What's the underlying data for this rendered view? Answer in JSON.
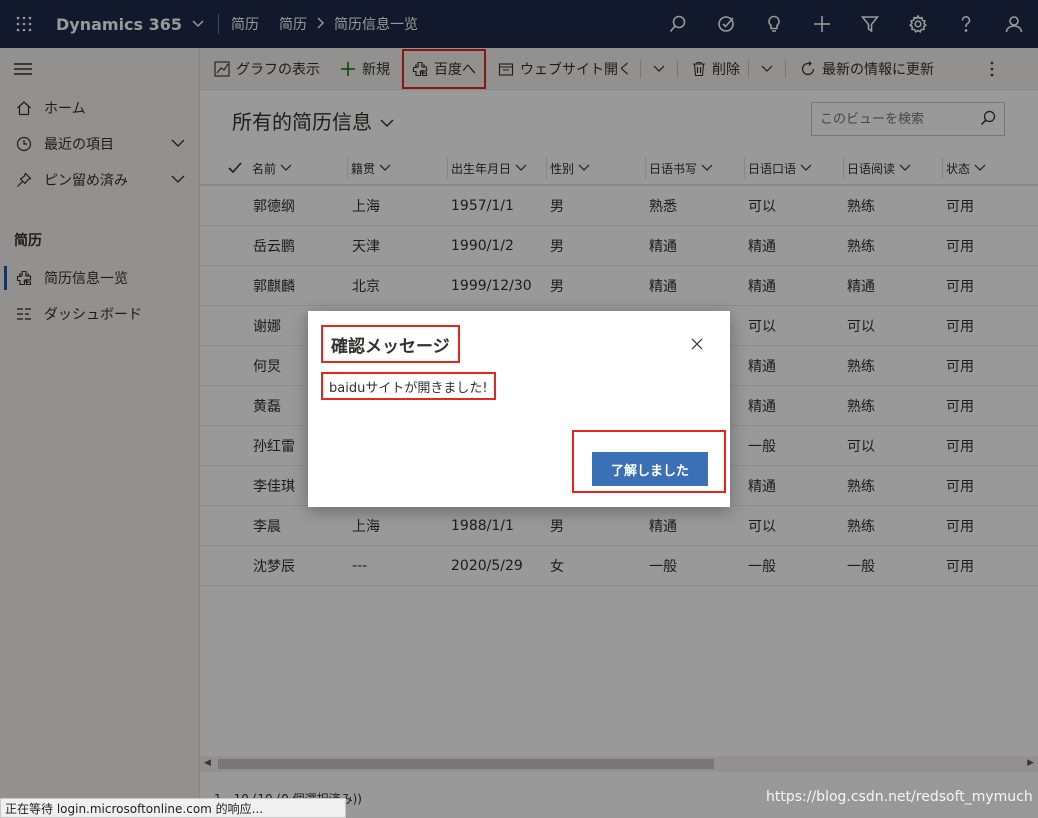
{
  "topbar": {
    "app_title": "Dynamics 365",
    "breadcrumb": [
      "简历",
      "简历",
      "简历信息一览"
    ]
  },
  "sidebar": {
    "items": [
      {
        "label": "ホーム",
        "icon": "home-icon"
      },
      {
        "label": "最近の項目",
        "icon": "clock-icon"
      },
      {
        "label": "ピン留め済み",
        "icon": "pin-icon"
      }
    ],
    "section": "简历",
    "entities": [
      {
        "label": "简历信息一览",
        "icon": "puzzle-icon",
        "active": true
      },
      {
        "label": "ダッシュボード",
        "icon": "dashboard-icon",
        "active": false
      }
    ]
  },
  "commands": {
    "chart": "グラフの表示",
    "new": "新規",
    "baidu": "百度へ",
    "website": "ウェブサイト開く",
    "delete": "削除",
    "refresh": "最新の情報に更新"
  },
  "view": {
    "title": "所有的简历信息",
    "search_placeholder": "このビューを検索"
  },
  "grid": {
    "columns": [
      "名前",
      "籍贯",
      "出生年月日",
      "性别",
      "日语书写",
      "日语口语",
      "日语阅读",
      "状态"
    ],
    "rows": [
      [
        "郭德纲",
        "上海",
        "1957/1/1",
        "男",
        "熟悉",
        "可以",
        "熟练",
        "可用"
      ],
      [
        "岳云鹏",
        "天津",
        "1990/1/2",
        "男",
        "精通",
        "精通",
        "熟练",
        "可用"
      ],
      [
        "郭麒麟",
        "北京",
        "1999/12/30",
        "男",
        "精通",
        "精通",
        "精通",
        "可用"
      ],
      [
        "谢娜",
        "",
        "",
        "",
        "",
        "可以",
        "可以",
        "可用"
      ],
      [
        "何炅",
        "",
        "",
        "",
        "",
        "精通",
        "熟练",
        "可用"
      ],
      [
        "黄磊",
        "",
        "",
        "",
        "",
        "精通",
        "熟练",
        "可用"
      ],
      [
        "孙红雷",
        "",
        "",
        "",
        "",
        "一般",
        "可以",
        "可用"
      ],
      [
        "李佳琪",
        "",
        "",
        "",
        "",
        "精通",
        "熟练",
        "可用"
      ],
      [
        "李晨",
        "上海",
        "1988/1/1",
        "男",
        "精通",
        "可以",
        "熟练",
        "可用"
      ],
      [
        "沈梦辰",
        "---",
        "2020/5/29",
        "女",
        "一般",
        "一般",
        "一般",
        "可用"
      ]
    ],
    "footer": "1 - 10 (10 (0 個選択済み))"
  },
  "dialog": {
    "title": "確認メッセージ",
    "message": "baiduサイトが開きました!",
    "ok_button": "了解しました"
  },
  "statusbar": {
    "text": "正在等待 login.microsoftonline.com 的响应..."
  },
  "watermark": "https://blog.csdn.net/redsoft_mymuch",
  "colors": {
    "topbar_bg": "#1e2a4a",
    "accent": "#3b6fb6",
    "highlight": "#e5261c"
  }
}
